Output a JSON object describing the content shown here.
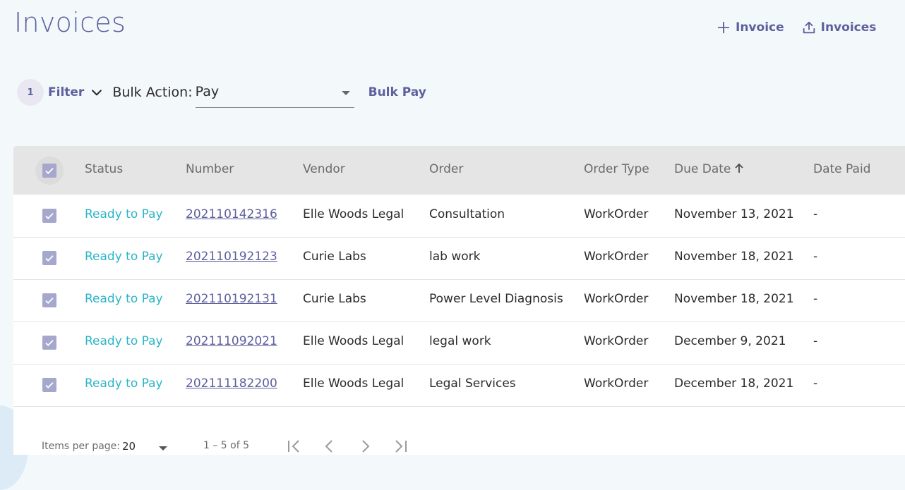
{
  "page": {
    "title": "Invoices"
  },
  "actions": {
    "add_invoice": "Invoice",
    "upload_invoices": "Invoices"
  },
  "toolbar": {
    "filter_count": "1",
    "filter_label": "Filter",
    "bulk_action_label": "Bulk Action:",
    "bulk_action_value": "Pay",
    "bulk_pay_label": "Bulk Pay"
  },
  "table": {
    "columns": [
      "Status",
      "Number",
      "Vendor",
      "Order",
      "Order Type",
      "Due Date",
      "Date Paid"
    ],
    "sorted_column": "Due Date",
    "sort_direction": "ascending",
    "rows": [
      {
        "checked": true,
        "status": "Ready to Pay",
        "number": "202110142316",
        "vendor": "Elle Woods Legal",
        "order": "Consultation",
        "order_type": "WorkOrder",
        "due_date": "November 13, 2021",
        "date_paid": "-"
      },
      {
        "checked": true,
        "status": "Ready to Pay",
        "number": "202110192123",
        "vendor": "Curie Labs",
        "order": "lab work",
        "order_type": "WorkOrder",
        "due_date": "November 18, 2021",
        "date_paid": "-"
      },
      {
        "checked": true,
        "status": "Ready to Pay",
        "number": "202110192131",
        "vendor": "Curie Labs",
        "order": "Power Level Diagnosis",
        "order_type": "WorkOrder",
        "due_date": "November 18, 2021",
        "date_paid": "-"
      },
      {
        "checked": true,
        "status": "Ready to Pay",
        "number": "202111092021",
        "vendor": "Elle Woods Legal",
        "order": "legal work",
        "order_type": "WorkOrder",
        "due_date": "December 9, 2021",
        "date_paid": "-"
      },
      {
        "checked": true,
        "status": "Ready to Pay",
        "number": "202111182200",
        "vendor": "Elle Woods Legal",
        "order": "Legal Services",
        "order_type": "WorkOrder",
        "due_date": "December 18, 2021",
        "date_paid": "-"
      }
    ]
  },
  "paginator": {
    "items_per_page_label": "Items per page:",
    "items_per_page": "20",
    "range_label": "1 – 5 of 5"
  },
  "colors": {
    "accent": "#5e5f9d",
    "status_ready": "#2bb5c7",
    "checkbox": "#a6a7cc",
    "header_bg": "#e5e5e5",
    "page_bg": "#f3f8fb"
  }
}
